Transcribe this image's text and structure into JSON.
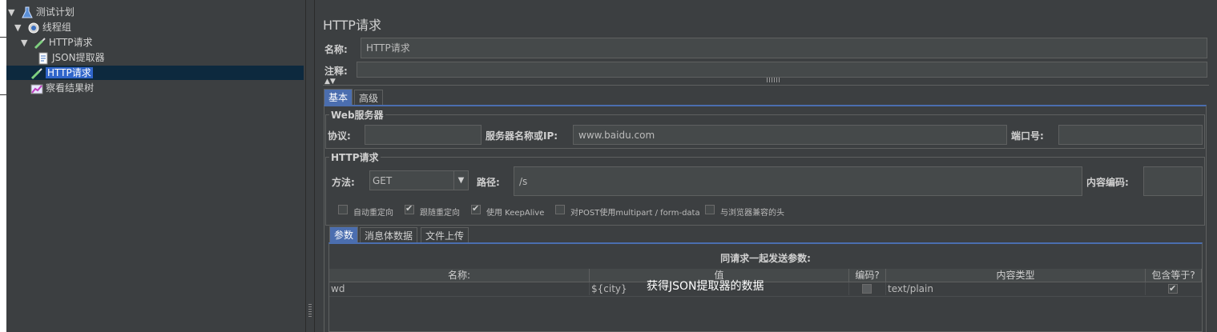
{
  "tree": {
    "items": [
      {
        "label": "测试计划",
        "icon": "flask-icon",
        "expanded": true
      },
      {
        "label": "线程组",
        "icon": "gear-icon",
        "expanded": true
      },
      {
        "label": "HTTP请求",
        "icon": "pipette-icon",
        "expanded": true
      },
      {
        "label": "JSON提取器",
        "icon": "document-icon"
      },
      {
        "label": "HTTP请求",
        "icon": "pipette-icon",
        "selected": true
      },
      {
        "label": "察看结果树",
        "icon": "chart-icon"
      }
    ]
  },
  "panel": {
    "title": "HTTP请求",
    "name_label": "名称:",
    "name_value": "HTTP请求",
    "comment_label": "注释:",
    "comment_value": ""
  },
  "tabs": {
    "basic": "基本",
    "advanced": "高级"
  },
  "web_server": {
    "title": "Web服务器",
    "protocol_label": "协议:",
    "protocol_value": "",
    "server_label": "服务器名称或IP:",
    "server_value": "www.baidu.com",
    "port_label": "端口号:",
    "port_value": ""
  },
  "http_request": {
    "title": "HTTP请求",
    "method_label": "方法:",
    "method_value": "GET",
    "path_label": "路径:",
    "path_value": "/s",
    "encoding_label": "内容编码:",
    "encoding_value": ""
  },
  "options": [
    {
      "label": "自动重定向",
      "checked": false
    },
    {
      "label": "跟随重定向",
      "checked": true
    },
    {
      "label": "使用 KeepAlive",
      "checked": true
    },
    {
      "label": "对POST使用multipart / form-data",
      "checked": false
    },
    {
      "label": "与浏览器兼容的头",
      "checked": false
    }
  ],
  "sub_tabs": {
    "params": "参数",
    "body": "消息体数据",
    "files": "文件上传"
  },
  "params_table": {
    "caption": "同请求一起发送参数:",
    "headers": [
      "名称:",
      "值",
      "编码?",
      "内容类型",
      "包含等于?"
    ],
    "rows": [
      {
        "name": "wd",
        "value": "${city}",
        "encode": false,
        "content_type": "text/plain",
        "include_equals": true
      }
    ]
  },
  "annotation": "获得JSON提取器的数据",
  "colors": {
    "background": "#3c3f41",
    "selection": "#2f65ca",
    "active_tab": "#4b6eaf"
  }
}
